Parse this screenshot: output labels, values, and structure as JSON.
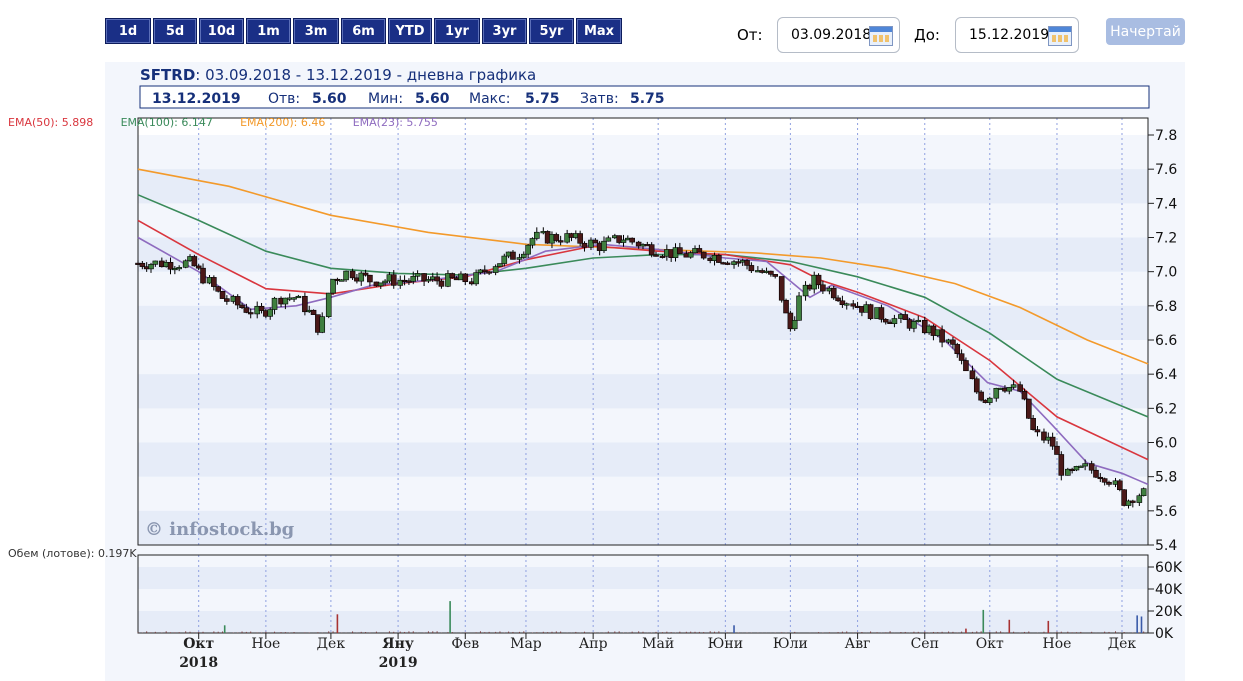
{
  "range_buttons": [
    "1d",
    "5d",
    "10d",
    "1m",
    "3m",
    "6m",
    "YTD",
    "1yr",
    "3yr",
    "5yr",
    "Max"
  ],
  "controls": {
    "from_label": "От:",
    "from_value": "03.09.2018",
    "to_label": "До:",
    "to_value": "15.12.2019",
    "draw_button": "Начертай"
  },
  "chart_data": {
    "type": "candlestick",
    "symbol": "SFTRD",
    "period_text": "03.09.2018 - 13.12.2019 - дневна графика",
    "ohlc_summary": {
      "date": "13.12.2019",
      "open_label": "Отв:",
      "open": "5.60",
      "low_label": "Мин:",
      "low": "5.60",
      "high_label": "Макс:",
      "high": "5.75",
      "close_label": "Затв:",
      "close": "5.75"
    },
    "legend": [
      {
        "name": "EMA(50)",
        "value": "5.898",
        "color": "#d9363e"
      },
      {
        "name": "EMA(100)",
        "value": "6.147",
        "color": "#3a8a5a"
      },
      {
        "name": "EMA(200)",
        "value": "6.46",
        "color": "#f39a2b"
      },
      {
        "name": "EMA(23)",
        "value": "5.755",
        "color": "#8e6bbf"
      }
    ],
    "watermark": "© infostock.bg",
    "price_axis": {
      "min": 5.4,
      "max": 7.8,
      "ticks": [
        "7.8",
        "7.6",
        "7.4",
        "7.2",
        "7.0",
        "6.8",
        "6.6",
        "6.4",
        "6.2",
        "6.0",
        "5.8",
        "5.6",
        "5.4"
      ]
    },
    "volume_label": "Обем (лотове): 0.197K",
    "volume_axis": {
      "min": 0,
      "max": 60,
      "ticks": [
        "60K",
        "40K",
        "20K",
        "0K"
      ]
    },
    "time_axis": {
      "start": "2018-09-03",
      "end": "2019-12-13",
      "labels": [
        {
          "label": "Окт",
          "date": "2018-10-01",
          "year": "2018"
        },
        {
          "label": "Ное",
          "date": "2018-11-01"
        },
        {
          "label": "Дек",
          "date": "2018-12-01"
        },
        {
          "label": "Яну",
          "date": "2019-01-01",
          "year": "2019"
        },
        {
          "label": "Фев",
          "date": "2019-02-01"
        },
        {
          "label": "Мар",
          "date": "2019-03-01"
        },
        {
          "label": "Апр",
          "date": "2019-04-01"
        },
        {
          "label": "Май",
          "date": "2019-05-01"
        },
        {
          "label": "Юни",
          "date": "2019-06-01"
        },
        {
          "label": "Юли",
          "date": "2019-07-01"
        },
        {
          "label": "Авг",
          "date": "2019-08-01"
        },
        {
          "label": "Сеп",
          "date": "2019-09-01"
        },
        {
          "label": "Окт",
          "date": "2019-10-01"
        },
        {
          "label": "Ное",
          "date": "2019-11-01"
        },
        {
          "label": "Дек",
          "date": "2019-12-01"
        }
      ]
    },
    "price_path": [
      [
        "2018-09-03",
        7.05
      ],
      [
        "2018-09-15",
        7.05
      ],
      [
        "2018-09-28",
        7.05
      ],
      [
        "2018-10-05",
        6.95
      ],
      [
        "2018-10-12",
        6.85
      ],
      [
        "2018-10-20",
        6.8
      ],
      [
        "2018-10-30",
        6.75
      ],
      [
        "2018-11-08",
        6.85
      ],
      [
        "2018-11-15",
        6.85
      ],
      [
        "2018-11-22",
        6.75
      ],
      [
        "2018-11-27",
        6.65
      ],
      [
        "2018-12-01",
        6.95
      ],
      [
        "2018-12-10",
        7.0
      ],
      [
        "2018-12-20",
        6.95
      ],
      [
        "2019-01-05",
        6.95
      ],
      [
        "2019-01-20",
        6.95
      ],
      [
        "2019-02-05",
        6.95
      ],
      [
        "2019-02-15",
        7.05
      ],
      [
        "2019-02-25",
        7.1
      ],
      [
        "2019-03-05",
        7.2
      ],
      [
        "2019-03-20",
        7.2
      ],
      [
        "2019-04-05",
        7.15
      ],
      [
        "2019-04-15",
        7.2
      ],
      [
        "2019-04-25",
        7.15
      ],
      [
        "2019-05-10",
        7.1
      ],
      [
        "2019-05-25",
        7.1
      ],
      [
        "2019-06-10",
        7.05
      ],
      [
        "2019-06-25",
        6.95
      ],
      [
        "2019-07-01",
        6.65
      ],
      [
        "2019-07-06",
        6.85
      ],
      [
        "2019-07-12",
        6.95
      ],
      [
        "2019-07-25",
        6.85
      ],
      [
        "2019-08-10",
        6.75
      ],
      [
        "2019-08-25",
        6.7
      ],
      [
        "2019-09-05",
        6.65
      ],
      [
        "2019-09-15",
        6.55
      ],
      [
        "2019-09-25",
        6.3
      ],
      [
        "2019-09-30",
        6.25
      ],
      [
        "2019-10-05",
        6.35
      ],
      [
        "2019-10-15",
        6.3
      ],
      [
        "2019-10-22",
        6.05
      ],
      [
        "2019-10-30",
        6.0
      ],
      [
        "2019-11-05",
        5.8
      ],
      [
        "2019-11-15",
        5.85
      ],
      [
        "2019-11-25",
        5.8
      ],
      [
        "2019-12-03",
        5.65
      ],
      [
        "2019-12-08",
        5.7
      ],
      [
        "2019-12-13",
        5.7
      ]
    ],
    "ema_series": [
      {
        "name": "EMA(200)",
        "color": "#f39a2b",
        "points": [
          [
            "2018-09-03",
            7.6
          ],
          [
            "2018-10-15",
            7.5
          ],
          [
            "2018-12-01",
            7.33
          ],
          [
            "2019-01-15",
            7.23
          ],
          [
            "2019-03-01",
            7.16
          ],
          [
            "2019-05-01",
            7.13
          ],
          [
            "2019-06-15",
            7.11
          ],
          [
            "2019-07-15",
            7.08
          ],
          [
            "2019-08-15",
            7.02
          ],
          [
            "2019-09-15",
            6.93
          ],
          [
            "2019-10-15",
            6.79
          ],
          [
            "2019-11-15",
            6.6
          ],
          [
            "2019-12-13",
            6.46
          ]
        ]
      },
      {
        "name": "EMA(100)",
        "color": "#3a8a5a",
        "points": [
          [
            "2018-09-03",
            7.45
          ],
          [
            "2018-10-01",
            7.3
          ],
          [
            "2018-11-01",
            7.12
          ],
          [
            "2018-12-01",
            7.02
          ],
          [
            "2019-01-01",
            6.99
          ],
          [
            "2019-02-01",
            6.98
          ],
          [
            "2019-03-01",
            7.02
          ],
          [
            "2019-04-01",
            7.08
          ],
          [
            "2019-05-01",
            7.1
          ],
          [
            "2019-06-01",
            7.1
          ],
          [
            "2019-07-01",
            7.06
          ],
          [
            "2019-08-01",
            6.97
          ],
          [
            "2019-09-01",
            6.85
          ],
          [
            "2019-10-01",
            6.64
          ],
          [
            "2019-11-01",
            6.37
          ],
          [
            "2019-12-13",
            6.15
          ]
        ]
      },
      {
        "name": "EMA(50)",
        "color": "#d9363e",
        "points": [
          [
            "2018-09-03",
            7.3
          ],
          [
            "2018-10-01",
            7.1
          ],
          [
            "2018-11-01",
            6.9
          ],
          [
            "2018-12-01",
            6.87
          ],
          [
            "2019-01-01",
            6.93
          ],
          [
            "2019-02-01",
            6.97
          ],
          [
            "2019-03-01",
            7.07
          ],
          [
            "2019-04-01",
            7.15
          ],
          [
            "2019-05-01",
            7.12
          ],
          [
            "2019-06-01",
            7.1
          ],
          [
            "2019-07-01",
            7.04
          ],
          [
            "2019-07-15",
            6.95
          ],
          [
            "2019-08-01",
            6.88
          ],
          [
            "2019-09-01",
            6.73
          ],
          [
            "2019-10-01",
            6.48
          ],
          [
            "2019-11-01",
            6.15
          ],
          [
            "2019-12-13",
            5.9
          ]
        ]
      },
      {
        "name": "EMA(23)",
        "color": "#8e6bbf",
        "points": [
          [
            "2018-09-03",
            7.2
          ],
          [
            "2018-10-01",
            7.0
          ],
          [
            "2018-10-25",
            6.78
          ],
          [
            "2018-11-15",
            6.8
          ],
          [
            "2018-12-01",
            6.85
          ],
          [
            "2018-12-20",
            6.92
          ],
          [
            "2019-01-15",
            6.95
          ],
          [
            "2019-02-15",
            7.0
          ],
          [
            "2019-03-10",
            7.12
          ],
          [
            "2019-04-05",
            7.16
          ],
          [
            "2019-05-01",
            7.13
          ],
          [
            "2019-06-01",
            7.08
          ],
          [
            "2019-06-20",
            7.06
          ],
          [
            "2019-07-10",
            6.85
          ],
          [
            "2019-07-20",
            6.92
          ],
          [
            "2019-08-15",
            6.8
          ],
          [
            "2019-09-10",
            6.6
          ],
          [
            "2019-09-30",
            6.35
          ],
          [
            "2019-10-15",
            6.3
          ],
          [
            "2019-10-30",
            6.1
          ],
          [
            "2019-11-15",
            5.88
          ],
          [
            "2019-12-01",
            5.82
          ],
          [
            "2019-12-13",
            5.755
          ]
        ]
      }
    ],
    "volume_spikes": [
      {
        "date": "2018-10-13",
        "value": 7,
        "color": "#3a8a5a"
      },
      {
        "date": "2018-12-04",
        "value": 17,
        "color": "#a83232"
      },
      {
        "date": "2019-01-25",
        "value": 29,
        "color": "#3a8a5a"
      },
      {
        "date": "2019-06-05",
        "value": 7,
        "color": "#3a5aa8"
      },
      {
        "date": "2019-09-20",
        "value": 4,
        "color": "#a83232"
      },
      {
        "date": "2019-09-28",
        "value": 21,
        "color": "#3a8a5a"
      },
      {
        "date": "2019-10-10",
        "value": 12,
        "color": "#a83232"
      },
      {
        "date": "2019-10-28",
        "value": 11,
        "color": "#a83232"
      },
      {
        "date": "2019-12-08",
        "value": 16,
        "color": "#3a5aa8"
      },
      {
        "date": "2019-12-10",
        "value": 15,
        "color": "#3a5aa8"
      }
    ]
  }
}
